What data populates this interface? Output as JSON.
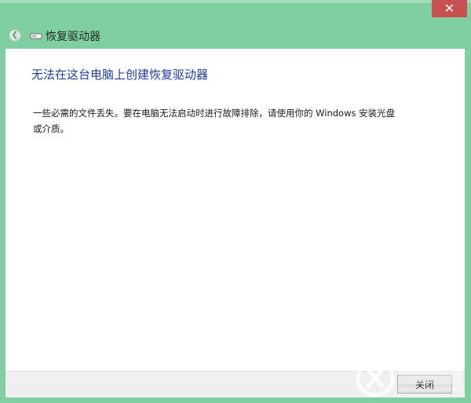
{
  "window": {
    "title": "恢复驱动器",
    "close_glyph": "✕",
    "back_glyph": "❮"
  },
  "content": {
    "heading": "无法在这台电脑上创建恢复驱动器",
    "message": "一些必需的文件丢失。要在电脑无法启动时进行故障排除，请使用你的 Windows 安装光盘或介质。"
  },
  "footer": {
    "button_label": "关闭"
  },
  "colors": {
    "frame": "#7fcfa0",
    "close_button": "#c75050",
    "heading": "#1f3e9b"
  },
  "icons": [
    "close-icon",
    "back-arrow-icon",
    "drive-icon"
  ]
}
